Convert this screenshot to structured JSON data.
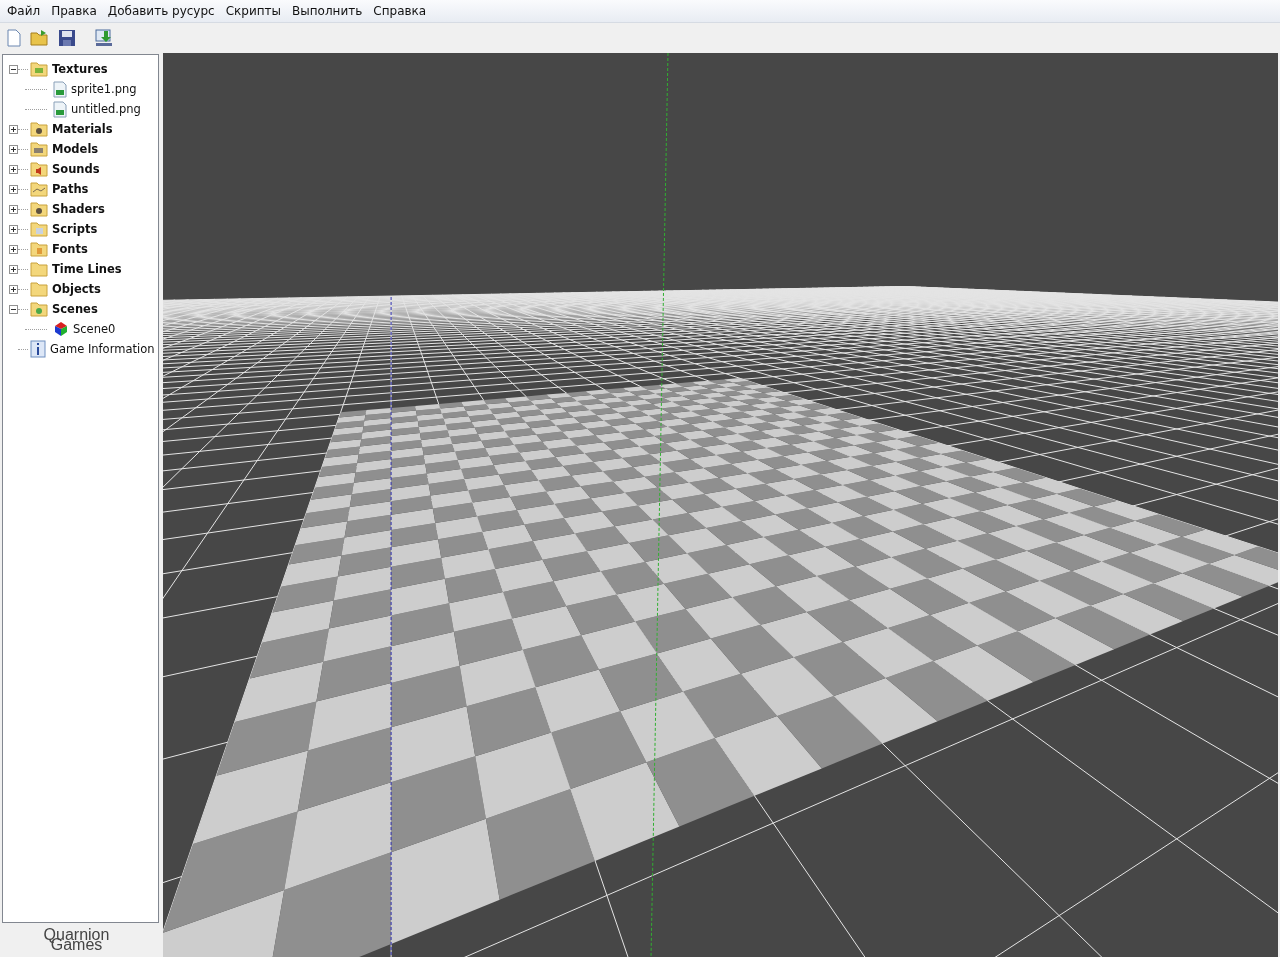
{
  "menu": [
    {
      "label": "Файл"
    },
    {
      "label": "Правка"
    },
    {
      "label": "Добавить русурс"
    },
    {
      "label": "Скрипты"
    },
    {
      "label": "Выполнить"
    },
    {
      "label": "Справка"
    }
  ],
  "toolbar": [
    {
      "kind": "new"
    },
    {
      "kind": "open"
    },
    {
      "kind": "save"
    },
    {
      "kind": "export"
    }
  ],
  "tree": [
    {
      "label": "Textures",
      "kind": "textures",
      "expanded": true,
      "children": [
        {
          "label": "sprite1.png",
          "kind": "image"
        },
        {
          "label": "untitled.png",
          "kind": "image"
        }
      ]
    },
    {
      "label": "Materials",
      "kind": "materials",
      "expanded": false
    },
    {
      "label": "Models",
      "kind": "models",
      "expanded": false
    },
    {
      "label": "Sounds",
      "kind": "sounds",
      "expanded": false
    },
    {
      "label": "Paths",
      "kind": "paths",
      "expanded": false
    },
    {
      "label": "Shaders",
      "kind": "materials",
      "expanded": false
    },
    {
      "label": "Scripts",
      "kind": "scripts",
      "expanded": false
    },
    {
      "label": "Fonts",
      "kind": "fonts",
      "expanded": false
    },
    {
      "label": "Time Lines",
      "kind": "folder",
      "expanded": false
    },
    {
      "label": "Objects",
      "kind": "folder",
      "expanded": false
    },
    {
      "label": "Scenes",
      "kind": "scenes",
      "expanded": true,
      "children": [
        {
          "label": "Scene0",
          "kind": "scene"
        }
      ]
    },
    {
      "label": "Game Information",
      "kind": "info"
    }
  ],
  "logo": {
    "line1": "Quarnion",
    "line2": "Games"
  }
}
